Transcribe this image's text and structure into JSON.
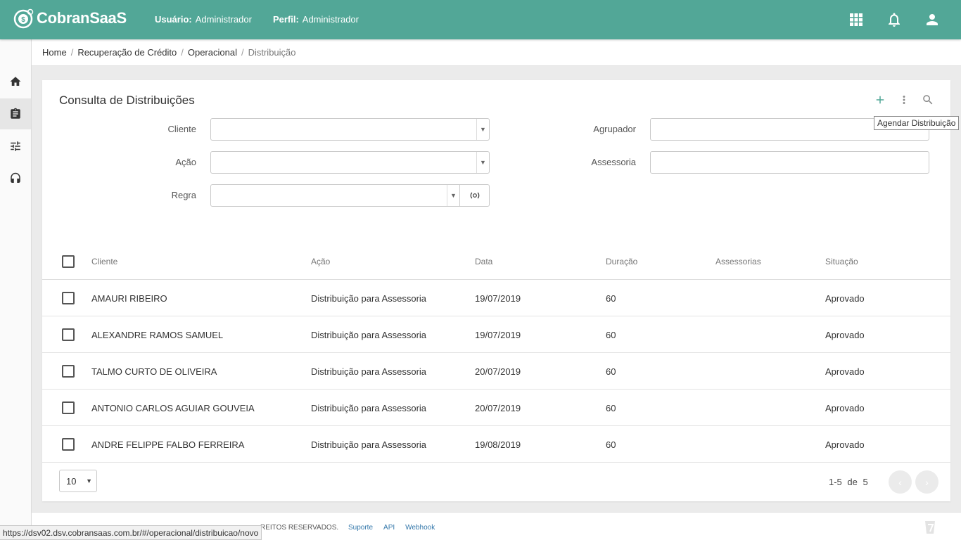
{
  "app": {
    "brand": "CobranSaaS",
    "user_label": "Usuário:",
    "user_value": "Administrador",
    "profile_label": "Perfil:",
    "profile_value": "Administrador",
    "accent_color": "#52a797"
  },
  "breadcrumb": [
    "Home",
    "Recuperação de Crédito",
    "Operacional",
    "Distribuição"
  ],
  "card": {
    "title": "Consulta de Distribuições",
    "tooltip": "Agendar Distribuição"
  },
  "filters": {
    "cliente": {
      "label": "Cliente",
      "value": ""
    },
    "acao": {
      "label": "Ação",
      "value": ""
    },
    "regra": {
      "label": "Regra",
      "value": ""
    },
    "agrupador": {
      "label": "Agrupador",
      "value": ""
    },
    "assessoria": {
      "label": "Assessoria",
      "value": ""
    }
  },
  "table": {
    "columns": [
      "Cliente",
      "Ação",
      "Data",
      "Duração",
      "Assessorias",
      "Situação"
    ],
    "rows": [
      {
        "cliente": "AMAURI RIBEIRO",
        "acao": "Distribuição para Assessoria",
        "data": "19/07/2019",
        "duracao": "60",
        "assessorias": "",
        "situacao": "Aprovado"
      },
      {
        "cliente": "ALEXANDRE RAMOS SAMUEL",
        "acao": "Distribuição para Assessoria",
        "data": "19/07/2019",
        "duracao": "60",
        "assessorias": "",
        "situacao": "Aprovado"
      },
      {
        "cliente": "TALMO CURTO DE OLIVEIRA",
        "acao": "Distribuição para Assessoria",
        "data": "20/07/2019",
        "duracao": "60",
        "assessorias": "",
        "situacao": "Aprovado"
      },
      {
        "cliente": "ANTONIO CARLOS AGUIAR GOUVEIA",
        "acao": "Distribuição para Assessoria",
        "data": "20/07/2019",
        "duracao": "60",
        "assessorias": "",
        "situacao": "Aprovado"
      },
      {
        "cliente": "ANDRE FELIPPE FALBO FERREIRA",
        "acao": "Distribuição para Assessoria",
        "data": "19/08/2019",
        "duracao": "60",
        "assessorias": "",
        "situacao": "Aprovado"
      }
    ]
  },
  "pagination": {
    "page_size": "10",
    "range": "1-5",
    "of_label": "de",
    "total": "5",
    "prev": "‹",
    "next": "›"
  },
  "footer": {
    "copyright_fragment": "REITOS RESERVADOS.",
    "links": [
      "Suporte",
      "API",
      "Webhook"
    ],
    "status_url": "https://dsv02.dsv.cobransaas.com.br/#/operacional/distribuicao/novo"
  }
}
